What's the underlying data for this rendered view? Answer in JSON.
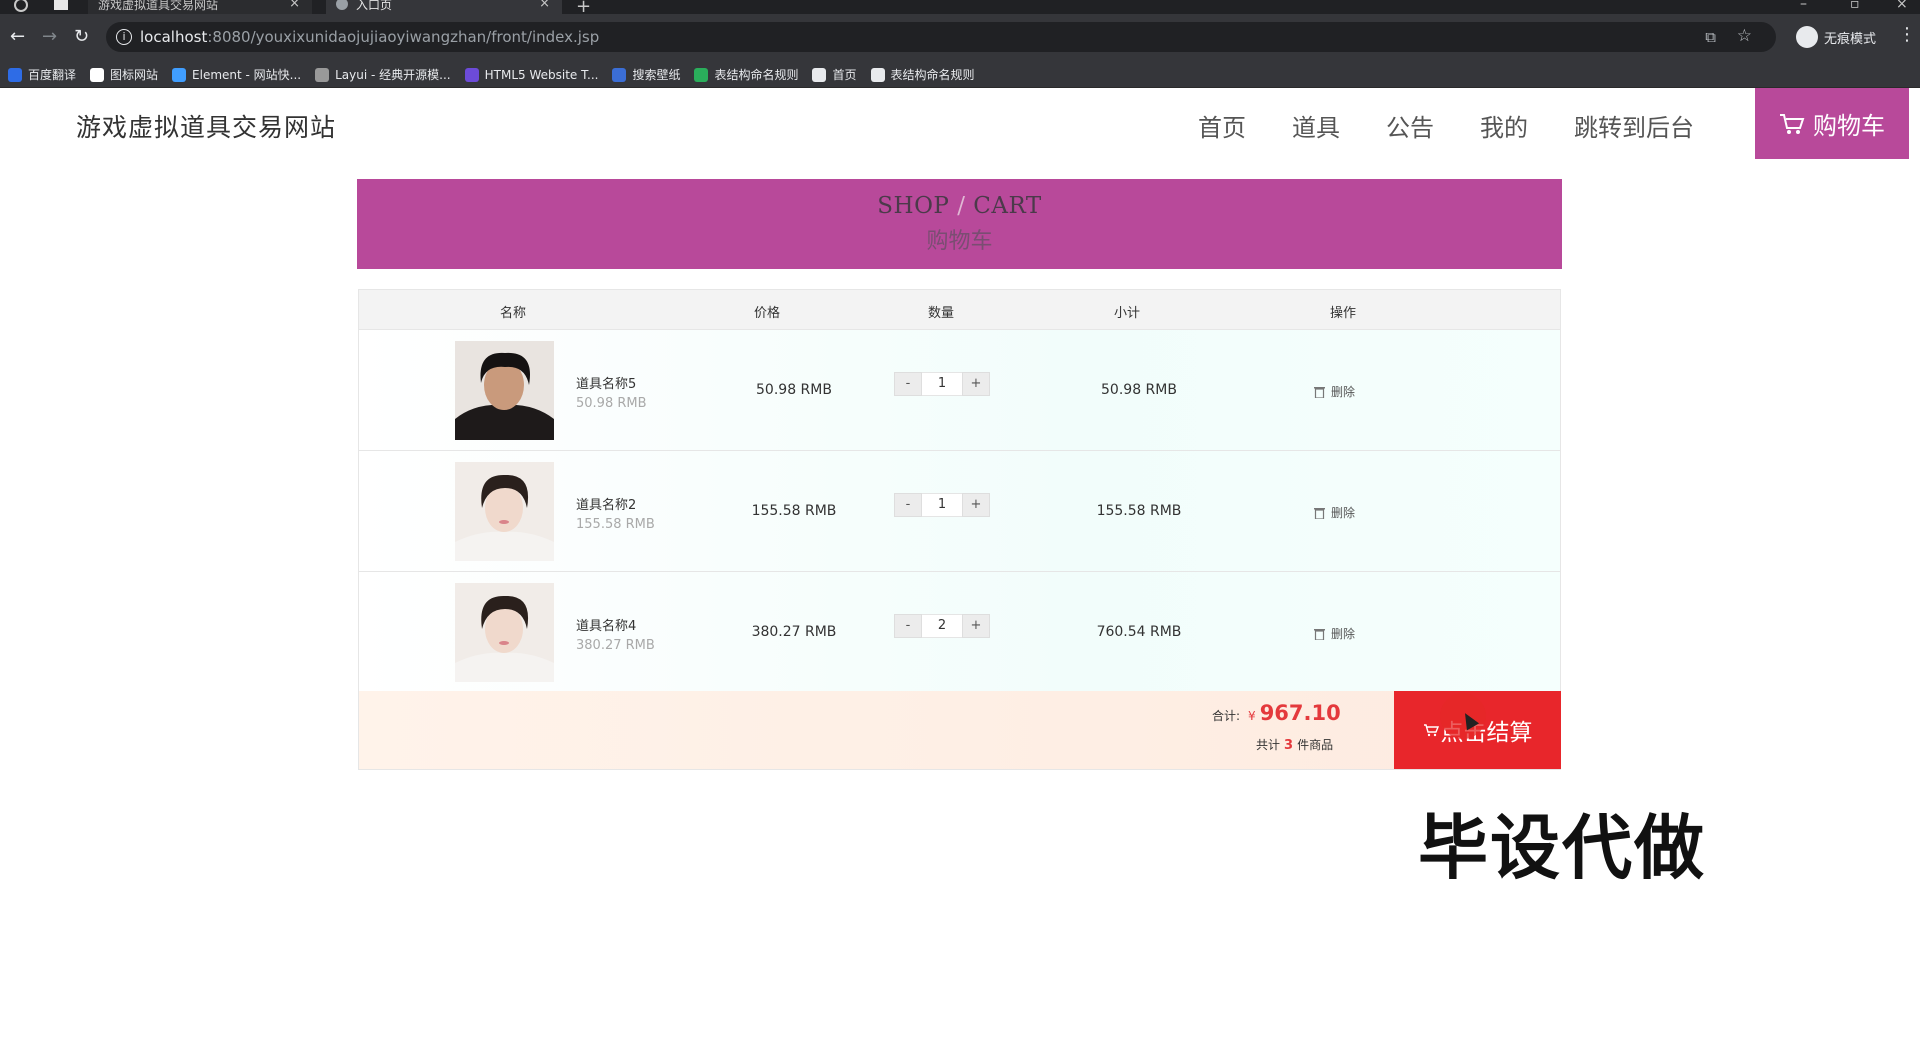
{
  "browser": {
    "tabs": [
      {
        "title": "游戏虚拟道具交易网站"
      },
      {
        "title": "入口页"
      }
    ],
    "url_host": "localhost",
    "url_rest": ":8080/youxixunidaojujiaoyiwangzhan/front/index.jsp",
    "incognito_label": "无痕模式",
    "bookmarks": [
      {
        "label": "百度翻译",
        "color": "#2e6ce6"
      },
      {
        "label": "图标网站",
        "color": "#ffffff"
      },
      {
        "label": "Element - 网站快...",
        "color": "#409eff"
      },
      {
        "label": "Layui - 经典开源模...",
        "color": "#999999"
      },
      {
        "label": "HTML5 Website T...",
        "color": "#6c4bd8"
      },
      {
        "label": "搜索壁纸",
        "color": "#3b6ed6"
      },
      {
        "label": "表结构命名规则",
        "color": "#2aae5b"
      },
      {
        "label": "首页",
        "color": "#e8eaed"
      },
      {
        "label": "表结构命名规则",
        "color": "#e8eaed"
      }
    ]
  },
  "site": {
    "title": "游戏虚拟道具交易网站",
    "nav": [
      "首页",
      "道具",
      "公告",
      "我的",
      "跳转到后台"
    ],
    "cart_label": "购物车",
    "accent": "#b8499a"
  },
  "banner": {
    "en_left": "SHOP",
    "en_sep": "/",
    "en_right": "CART",
    "cn": "购物车"
  },
  "table": {
    "headers": [
      "名称",
      "价格",
      "数量",
      "小计",
      "操作"
    ],
    "rows": [
      {
        "name": "道具名称5",
        "price_small": "50.98 RMB",
        "price": "50.98 RMB",
        "qty": "1",
        "subtotal": "50.98 RMB",
        "action": "删除"
      },
      {
        "name": "道具名称2",
        "price_small": "155.58 RMB",
        "price": "155.58 RMB",
        "qty": "1",
        "subtotal": "155.58 RMB",
        "action": "删除"
      },
      {
        "name": "道具名称4",
        "price_small": "380.27 RMB",
        "price": "380.27 RMB",
        "qty": "2",
        "subtotal": "760.54 RMB",
        "action": "删除"
      }
    ],
    "minus": "-",
    "plus": "+"
  },
  "summary": {
    "total_label": "合计:",
    "currency": "¥",
    "total": "967.10",
    "count_prefix": "共计",
    "count": "3",
    "count_suffix": "件商品",
    "checkout_label": "点击结算",
    "checkout_color": "#e8262b"
  },
  "watermark": "毕设代做"
}
